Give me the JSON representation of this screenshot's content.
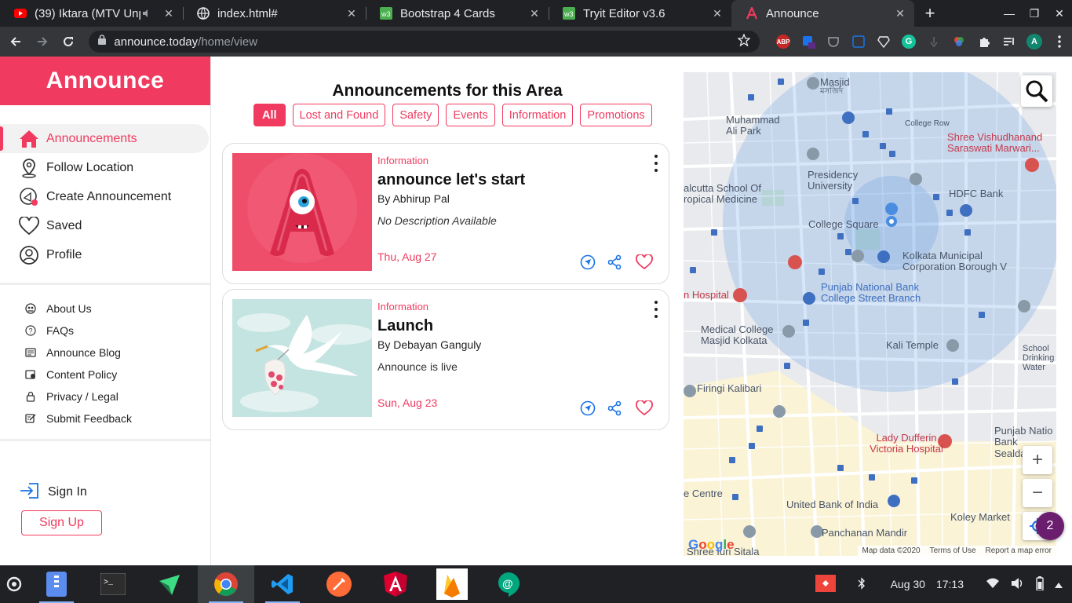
{
  "browser": {
    "tabs": [
      {
        "title": "(39) Iktara (MTV Unp",
        "icon": "youtube-icon",
        "active": false
      },
      {
        "title": "index.html#",
        "icon": "globe-icon",
        "active": false
      },
      {
        "title": "Bootstrap 4 Cards",
        "icon": "w3schools-icon",
        "active": false
      },
      {
        "title": "Tryit Editor v3.6",
        "icon": "w3schools-icon",
        "active": false
      },
      {
        "title": "Announce",
        "icon": "announce-icon",
        "active": true
      }
    ],
    "url_host": "announce.today",
    "url_path": "/home/view",
    "extensions": [
      "ABP",
      "3",
      "G",
      "A"
    ]
  },
  "app": {
    "brand": "Announce",
    "menu": [
      {
        "label": "Announcements",
        "icon": "home-icon",
        "active": true
      },
      {
        "label": "Follow Location",
        "icon": "location-pin-icon",
        "active": false
      },
      {
        "label": "Create Announcement",
        "icon": "create-announcement-icon",
        "active": false
      },
      {
        "label": "Saved",
        "icon": "heart-icon",
        "active": false
      },
      {
        "label": "Profile",
        "icon": "profile-icon",
        "active": false
      }
    ],
    "secondary": [
      {
        "label": "About Us",
        "icon": "about-icon"
      },
      {
        "label": "FAQs",
        "icon": "question-icon"
      },
      {
        "label": "Announce Blog",
        "icon": "blog-icon"
      },
      {
        "label": "Content Policy",
        "icon": "policy-icon"
      },
      {
        "label": "Privacy / Legal",
        "icon": "lock-icon"
      },
      {
        "label": "Submit Feedback",
        "icon": "feedback-icon"
      }
    ],
    "sign_in": "Sign In",
    "sign_up": "Sign Up"
  },
  "main": {
    "heading": "Announcements for this Area",
    "filters": [
      "All",
      "Lost and Found",
      "Safety",
      "Events",
      "Information",
      "Promotions"
    ],
    "active_filter": "All",
    "cards": [
      {
        "category": "Information",
        "title": "announce let's start",
        "author": "By Abhirup Pal",
        "description": "No Description Available",
        "description_placeholder": true,
        "date": "Thu, Aug 27"
      },
      {
        "category": "Information",
        "title": "Launch",
        "author": "By Debayan Ganguly",
        "description": "Announce is live",
        "description_placeholder": false,
        "date": "Sun, Aug 23"
      }
    ]
  },
  "map": {
    "labels": [
      {
        "text": "Masjid",
        "sub": "মসজিদ"
      },
      {
        "text": "Muhammad Ali Park"
      },
      {
        "text": "College Row"
      },
      {
        "text": "Shree Vishudhanand Saraswati Marwari..."
      },
      {
        "text": "Presidency University"
      },
      {
        "text": "HDFC Bank"
      },
      {
        "text": "alcutta School Of ropical Medicine"
      },
      {
        "text": "College Square"
      },
      {
        "text": "Kolkata Municipal Corporation Borough V"
      },
      {
        "text": "Punjab National Bank College Street Branch"
      },
      {
        "text": "n Hospital"
      },
      {
        "text": "Medical College Masjid Kolkata"
      },
      {
        "text": "Kali Temple"
      },
      {
        "text": "School Drinking Water"
      },
      {
        "text": "Firingi Kalibari"
      },
      {
        "text": "Lady Dufferin Victoria Hospital"
      },
      {
        "text": "Punjab Natio Bank Sealdah Br"
      },
      {
        "text": "e Centre"
      },
      {
        "text": "United Bank of India"
      },
      {
        "text": "Koley Market"
      },
      {
        "text": "Panchanan Mandir"
      },
      {
        "text": "Shree Iuri Sitala"
      }
    ],
    "google_logo": "Google",
    "credits": [
      "Map data ©2020",
      "Terms of Use",
      "Report a map error"
    ],
    "zoom_in": "+",
    "zoom_out": "−",
    "notification_count": "2"
  },
  "taskbar": {
    "apps": [
      "launcher-icon",
      "files-icon",
      "terminal-icon",
      "android-studio-icon",
      "chrome-icon",
      "vscode-icon",
      "postman-icon",
      "angular-icon",
      "firebase-icon",
      "hangouts-icon"
    ],
    "date": "Aug 30",
    "time": "17:13"
  },
  "colors": {
    "accent": "#f03a5f",
    "map_circle": "#4a8de0"
  }
}
